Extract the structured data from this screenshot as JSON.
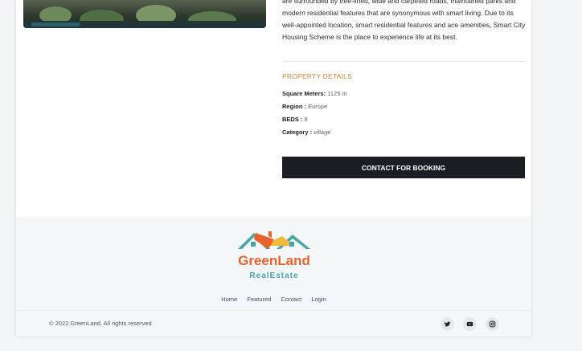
{
  "description": {
    "text": "are surrounded by tree-lined, wide and carpeted roads, maintained parks and modern residential features that are synonymous with smart living. Due to its well-appointed location, smart residential features and ace amenities, Smart City Housing Scheme is the place to experience life at its best."
  },
  "property_details": {
    "title": "PROPERTY DETAILS",
    "items": [
      {
        "label": "Square Meters:",
        "value": "1125 m"
      },
      {
        "label": "Region :",
        "value": "Europe"
      },
      {
        "label": "BEDS :",
        "value": "8"
      },
      {
        "label": "Category :",
        "value": "village"
      }
    ]
  },
  "booking": {
    "button_label": "CONTACT FOR BOOKING"
  },
  "footer": {
    "logo": {
      "name": "GreenLand",
      "tagline": "RealEstate"
    },
    "nav": [
      "Home",
      "Featured",
      "Contact",
      "Login"
    ],
    "copyright": "© 2022 GreenLand. All rights reserved",
    "social": [
      "twitter-icon",
      "youtube-icon",
      "instagram-icon"
    ]
  },
  "colors": {
    "accent": "#c9873a",
    "button": "#1b1d23",
    "logo_orange": "#e8632b",
    "logo_teal": "#4aa3a8"
  }
}
